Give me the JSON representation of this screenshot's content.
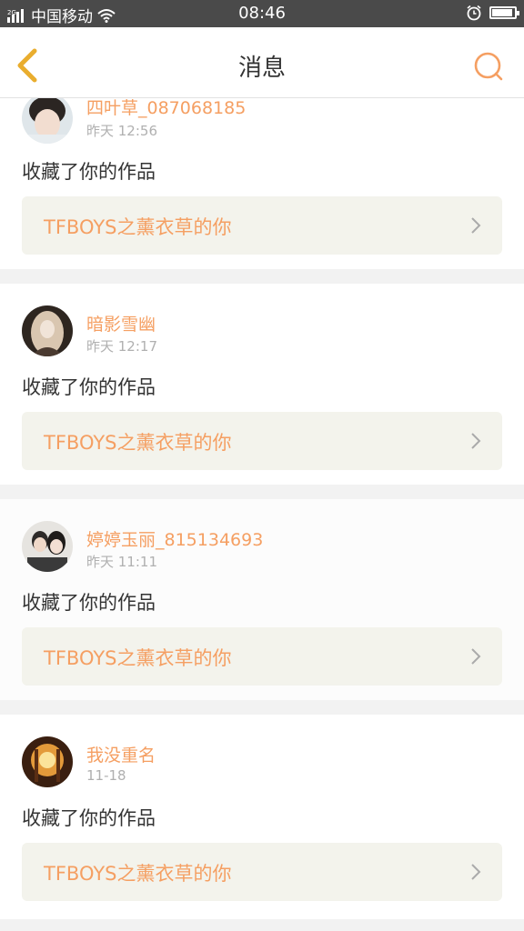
{
  "status_bar": {
    "carrier": "中国移动",
    "time": "08:46",
    "signal_tag": "2G"
  },
  "header": {
    "title": "消息"
  },
  "colors": {
    "accent": "#f59f62",
    "work_bg": "#f3f3ec"
  },
  "messages": [
    {
      "username": "四叶草_087068185",
      "time": "昨天 12:56",
      "action": "收藏了你的作品",
      "work_title": "TFBOYS之薰衣草的你"
    },
    {
      "username": "暗影雪幽",
      "time": "昨天 12:17",
      "action": "收藏了你的作品",
      "work_title": "TFBOYS之薰衣草的你"
    },
    {
      "username": "婷婷玉丽_815134693",
      "time": "昨天 11:11",
      "action": "收藏了你的作品",
      "work_title": "TFBOYS之薰衣草的你"
    },
    {
      "username": "我没重名",
      "time": "11-18",
      "action": "收藏了你的作品",
      "work_title": "TFBOYS之薰衣草的你"
    }
  ]
}
